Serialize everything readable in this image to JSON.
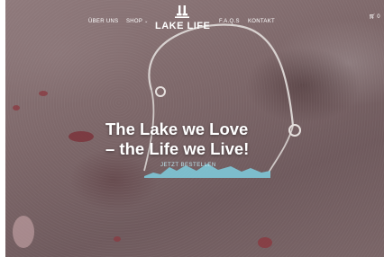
{
  "nav": {
    "about": "ÜBER UNS",
    "shop": "SHOP",
    "faqs": "F.A.Q.S",
    "contact": "KONTAKT"
  },
  "logo": {
    "text": "LAKE LIFE"
  },
  "cart": {
    "count": "0"
  },
  "hero": {
    "headline_line1": "The Lake we Love",
    "headline_line2": "– the Life we Live!",
    "cta_label": "JETZT BESTELLEN"
  },
  "colors": {
    "text": "#ffffff",
    "accent": "#7ec8d8",
    "background": "#7d6769"
  },
  "icons": {
    "logo": "lake-life-logo-icon",
    "cart": "cart-icon",
    "dropdown": "chevron-down-icon"
  }
}
